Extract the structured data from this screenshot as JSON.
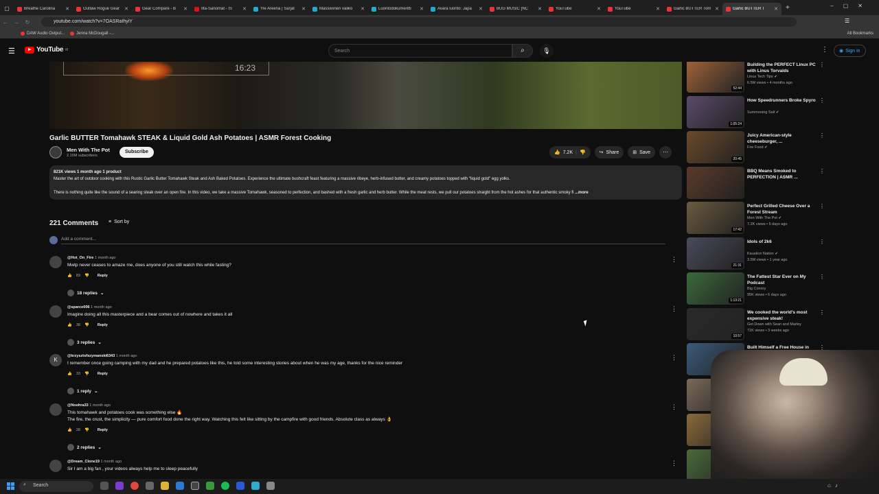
{
  "browser": {
    "tabs": [
      {
        "label": "Breathe Carolina",
        "color": "#e33"
      },
      {
        "label": "Outlaw Rogue Gear",
        "color": "#e33"
      },
      {
        "label": "Gear Compare - B",
        "color": "#e33"
      },
      {
        "label": "Ilta-Sanomat - IS",
        "color": "#d11"
      },
      {
        "label": "Yle Areena | Sarjat",
        "color": "#2ac"
      },
      {
        "label": "Massiivinen valiko",
        "color": "#2ac"
      },
      {
        "label": "Luontodokumentti",
        "color": "#2ac"
      },
      {
        "label": "Avara luonto: Japa",
        "color": "#2ac"
      },
      {
        "label": "BUG MUSIC [NC",
        "color": "#e33"
      },
      {
        "label": "YouTube",
        "color": "#e33"
      },
      {
        "label": "YouTube",
        "color": "#e33"
      },
      {
        "label": "Garlic BUTTER Tom",
        "color": "#e33"
      },
      {
        "label": "Garlic BUTTER T",
        "color": "#e33"
      }
    ],
    "url": "youtube.com/watch?v=7OASRaIhyiY",
    "bookmarks": [
      "DAW Audio Output...",
      "Jenna McDougall -..."
    ],
    "all_bookmarks": "All Bookmarks"
  },
  "masthead": {
    "logo": "YouTube",
    "region": "FI",
    "search_placeholder": "Search",
    "signin": "Sign in"
  },
  "video": {
    "duration_overlay": "16:23",
    "title": "Garlic BUTTER Tomahawk STEAK & Liquid Gold Ash Potatoes | ASMR Forest Cooking",
    "channel": "Men With The Pot",
    "subscribers": "2.15M subscribers",
    "subscribe": "Subscribe",
    "likes": "7.2K",
    "share": "Share",
    "save": "Save",
    "desc_meta": "821K views  1 month ago  1 product",
    "desc_line1": "Master the art of outdoor cooking with this Rustic Garlic Butter Tomahawk Steak and Ash Baked Potatoes. Experience the ultimate bushcraft feast featuring a massive ribeye, herb-infused butter, and creamy potatoes topped with \"liquid gold\" egg yolks.",
    "desc_line2": "There is nothing quite like the sound of a searing steak over an open fire. In this video, we take a massive Tomahawk, seasoned to perfection, and bashed with a fresh garlic and herb butter. While the meat rests, we pull our potatoes straight from the hot ashes for that authentic smoky fl",
    "more": "...more"
  },
  "comments": {
    "count": "221 Comments",
    "sort": "Sort by",
    "add": "Add a comment...",
    "items": [
      {
        "user": "@Hot_On_Fire",
        "time": "1 month ago",
        "text": "Mwtp never ceases to amaze me, does anyone of you still watch this while fasting?",
        "likes": "83",
        "replies": "18 replies",
        "avatar": ""
      },
      {
        "user": "@sparco006",
        "time": "1 month ago",
        "text": "Imagine doing all this masterpiece and a bear comes out of nowhere and takes it all",
        "likes": "38",
        "replies": "3 replies",
        "avatar": ""
      },
      {
        "user": "@krzysztofszymanski6343",
        "time": "1 month ago",
        "text": "I remember once going camping with my dad and he prepared potatoes like this, he told some interesting stories about when he was my age, thanks for the nice reminder",
        "likes": "33",
        "replies": "1 reply",
        "avatar": "K"
      },
      {
        "user": "@Noohra33",
        "time": "1 month ago",
        "text": "This tomahawk and potatoes cook was something else 🔥",
        "text2": "The fire, the crust, the simplicity — pure comfort food done the right way. Watching this felt like sitting by the campfire with good friends. Absolute class as always 👌",
        "likes": "28",
        "replies": "2 replies",
        "avatar": ""
      },
      {
        "user": "@Dream_Clone19",
        "time": "1 month ago",
        "text": "Sir I am a big fan , your videos always help me to sleep peacefully",
        "likes": "",
        "replies": "",
        "avatar": ""
      }
    ],
    "reply_label": "Reply"
  },
  "sidebar": [
    {
      "title": "Building the PERFECT Linux PC\nwith Linus Torvalds",
      "channel": "Linus Tech Tips ✔",
      "views": "6.5M views • 4 months ago",
      "duration": "52:44",
      "thumb": "#a0623a"
    },
    {
      "title": "How Speedrunners Broke Spyro",
      "channel": "Summoning Salt ✔",
      "views": "",
      "duration": "1:05:24",
      "thumb": "#5a4a6a"
    },
    {
      "title": "Juicy American-style cheeseburger, ...",
      "channel": "Fire Food ✔",
      "views": "",
      "duration": "20:45",
      "thumb": "#6a4a2a"
    },
    {
      "title": "BBQ Means Smoked to\nPERFECTION | ASMR ...",
      "channel": "",
      "views": "",
      "duration": "",
      "thumb": "#5a3a2a"
    },
    {
      "title": "Perfect Grilled Cheese Over a\nForest Stream",
      "channel": "Men With The Pot ✔",
      "views": "7.2K views • 5 days ago",
      "duration": "17:42",
      "thumb": "#6a5a40"
    },
    {
      "title": "Idols of 2k6",
      "channel": "Kaustion Nation ✔",
      "views": "3.5M views • 1 year ago",
      "duration": "21:31",
      "thumb": "#4a4a5a"
    },
    {
      "title": "The Fattest Star Ever on My\nPodcast",
      "channel": "Big Conroy",
      "views": "95K views • 6 days ago",
      "duration": "1:13:21",
      "thumb": "#3a6a3a"
    },
    {
      "title": "We cooked the world's most\nexpensive steak!",
      "channel": "Get Down with Sean and Marley",
      "views": "71K views • 3 weeks ago",
      "duration": "10:57",
      "thumb": "#2a2a2a"
    },
    {
      "title": "Built Himself a Free House in\nthe Mountains Alone",
      "channel": "Lesney ✔",
      "views": "15M views • 8 mo",
      "duration": "1:00:06",
      "thumb": "#3a5a7a"
    },
    {
      "title": "Best Of The Ir...",
      "channel": "",
      "views": "",
      "duration": "",
      "thumb": "#7a6a5a"
    },
    {
      "title": "",
      "channel": "",
      "views": "",
      "duration": "",
      "thumb": "#8a6a3a"
    },
    {
      "title": "",
      "channel": "",
      "views": "",
      "duration": "",
      "thumb": "#4a6a3a"
    }
  ],
  "taskbar": {
    "search": "Search"
  }
}
